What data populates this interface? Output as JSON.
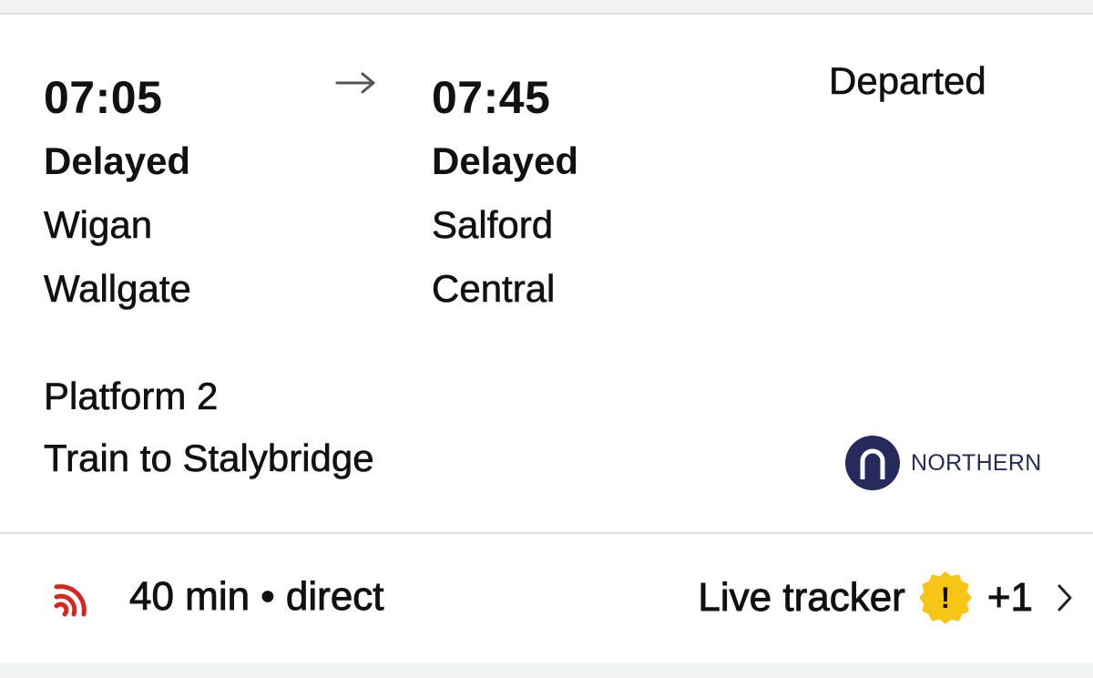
{
  "journey": {
    "departure": {
      "time": "07:05",
      "status": "Delayed",
      "station_line1": "Wigan",
      "station_line2": "Wallgate"
    },
    "arrival": {
      "time": "07:45",
      "status": "Delayed",
      "station_line1": "Salford",
      "station_line2": "Central"
    },
    "arrow_icon": "right-arrow-icon",
    "train_status": "Departed",
    "platform": "Platform 2",
    "service": "Train to Stalybridge",
    "operator": {
      "name": "NORTHERN",
      "brand_color": "#262a5c"
    }
  },
  "footer": {
    "live_icon": "live-signal-icon",
    "live_color": "#d7261e",
    "duration": "40 min • direct",
    "tracker_label": "Live tracker",
    "alert_icon": "warning-badge-icon",
    "alert_symbol": "!",
    "alert_color": "#f6c516",
    "alert_count": "+1",
    "chevron_icon": "chevron-right-icon"
  }
}
